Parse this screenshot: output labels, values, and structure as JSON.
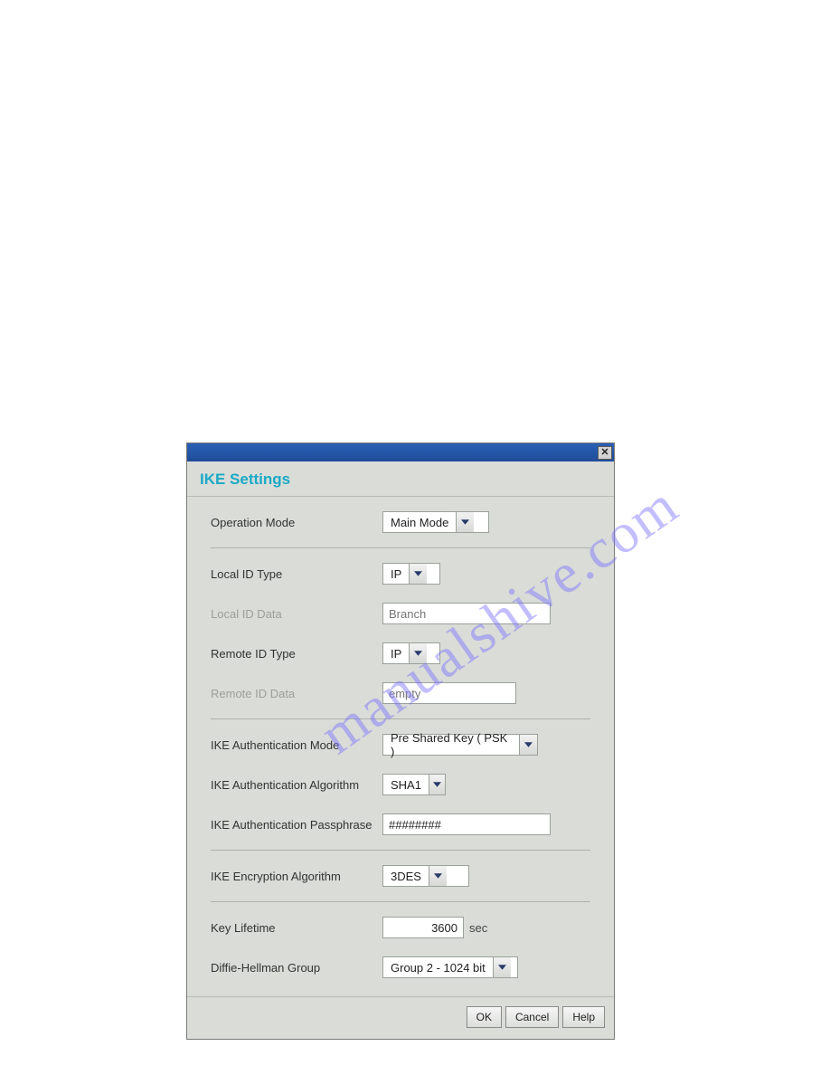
{
  "watermark_text": "manualshive.com",
  "header_title": "IKE Settings",
  "fields": {
    "operation_mode": {
      "label": "Operation Mode",
      "value": "Main Mode"
    },
    "local_id_type": {
      "label": "Local ID Type",
      "value": "IP"
    },
    "local_id_data": {
      "label": "Local ID Data",
      "placeholder": "Branch"
    },
    "remote_id_type": {
      "label": "Remote ID Type",
      "value": "IP"
    },
    "remote_id_data": {
      "label": "Remote ID Data",
      "placeholder": "empty"
    },
    "ike_auth_mode": {
      "label": "IKE Authentication Mode",
      "value": "Pre Shared Key ( PSK )"
    },
    "ike_auth_algo": {
      "label": "IKE Authentication Algorithm",
      "value": "SHA1"
    },
    "ike_auth_pass": {
      "label": "IKE Authentication Passphrase",
      "value": "########"
    },
    "ike_enc_algo": {
      "label": "IKE Encryption Algorithm",
      "value": "3DES"
    },
    "key_lifetime": {
      "label": "Key Lifetime",
      "value": "3600",
      "unit": "sec"
    },
    "dh_group": {
      "label": "Diffie-Hellman Group",
      "value": "Group 2 - 1024 bit"
    }
  },
  "buttons": {
    "ok": "OK",
    "cancel": "Cancel",
    "help": "Help"
  }
}
